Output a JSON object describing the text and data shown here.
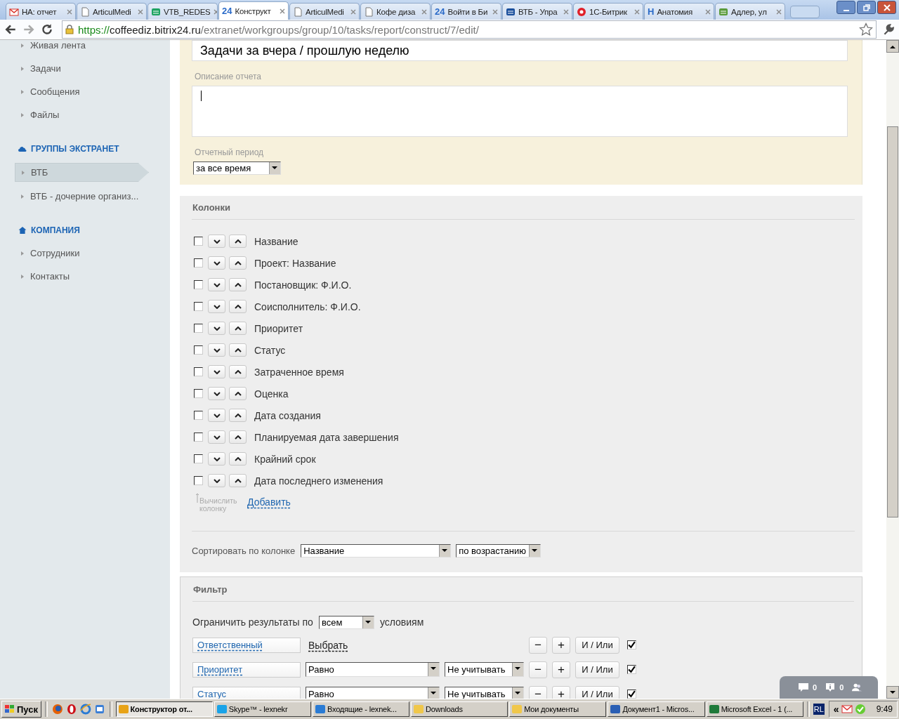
{
  "browser": {
    "tabs": [
      {
        "title": "НА: отчет",
        "kind": "mail",
        "selected": false
      },
      {
        "title": "ArticulMedi",
        "kind": "doc",
        "selected": false
      },
      {
        "title": "VTB_REDES",
        "kind": "sheet",
        "selected": false
      },
      {
        "title": "Конструкт",
        "kind": "mark",
        "mark": "24",
        "selected": true
      },
      {
        "title": "ArticulMedi",
        "kind": "doc",
        "selected": false
      },
      {
        "title": "Кофе диза",
        "kind": "doc",
        "selected": false
      },
      {
        "title": "Войти в Би",
        "kind": "mark",
        "mark": "24",
        "selected": false
      },
      {
        "title": "ВТБ - Упра",
        "kind": "bank",
        "selected": false
      },
      {
        "title": "1С-Битрик",
        "kind": "circle",
        "selected": false
      },
      {
        "title": "Анатомия",
        "kind": "mark",
        "mark": "H",
        "selected": false
      },
      {
        "title": "Адлер, ул",
        "kind": "map",
        "selected": false
      }
    ],
    "url_scheme": "https://",
    "url_host": "coffeediz.bitrix24.ru",
    "url_path": "/extranet/workgroups/group/10/tasks/report/construct/7/edit/"
  },
  "sidebar": {
    "sections": [
      {
        "items": [
          {
            "label": "Живая лента",
            "selected": false
          },
          {
            "label": "Задачи",
            "selected": false
          },
          {
            "label": "Сообщения",
            "selected": false
          },
          {
            "label": "Файлы",
            "selected": false
          }
        ]
      },
      {
        "title": "ГРУППЫ ЭКСТРАНЕТ",
        "kind": "cloud",
        "items": [
          {
            "label": "ВТБ",
            "selected": true
          },
          {
            "label": "ВТБ - дочерние организ...",
            "selected": false
          }
        ]
      },
      {
        "title": "КОМПАНИЯ",
        "kind": "home",
        "items": [
          {
            "label": "Сотрудники",
            "selected": false
          },
          {
            "label": "Контакты",
            "selected": false
          }
        ]
      }
    ]
  },
  "report": {
    "title_value": "Задачи за вчера / прошлую неделю",
    "description_label": "Описание отчета",
    "period_label": "Отчетный период",
    "period_value": "за все время"
  },
  "columns": {
    "title": "Колонки",
    "rows": [
      {
        "label": "Название",
        "checked": false
      },
      {
        "label": "Проект: Название",
        "checked": false
      },
      {
        "label": "Постановщик: Ф.И.О.",
        "checked": false
      },
      {
        "label": "Соисполнитель: Ф.И.О.",
        "checked": false
      },
      {
        "label": "Приоритет",
        "checked": false
      },
      {
        "label": "Статус",
        "checked": false
      },
      {
        "label": "Затраченное время",
        "checked": false
      },
      {
        "label": "Оценка",
        "checked": false
      },
      {
        "label": "Дата создания",
        "checked": false
      },
      {
        "label": "Планируемая дата завершения",
        "checked": false
      },
      {
        "label": "Крайний срок",
        "checked": false
      },
      {
        "label": "Дата последнего изменения",
        "checked": false
      }
    ],
    "calc_hint": "Вычислить колонку",
    "add_link": "Добавить",
    "sort_label": "Сортировать по колонке",
    "sort_value": "Название",
    "order_value": "по возрастанию"
  },
  "filter": {
    "title": "Фильтр",
    "limit_prefix": "Ограничить результаты по",
    "limit_value": "всем",
    "limit_suffix": "условиям",
    "conditions": [
      {
        "field": "Ответственный",
        "kind": "choose",
        "choose": "Выбрать",
        "minus": "−",
        "plus": "+",
        "andor": "И / Или",
        "checked": true
      },
      {
        "field": "Приоритет",
        "kind": "compare",
        "operator": "Равно",
        "value": "Не учитывать",
        "minus": "−",
        "plus": "+",
        "andor": "И / Или",
        "checked": true
      },
      {
        "field": "Статус",
        "kind": "compare",
        "operator": "Равно",
        "value": "Не учитывать",
        "minus": "−",
        "plus": "+",
        "andor": "И / Или",
        "checked": true
      }
    ]
  },
  "widget": {
    "messages": "0",
    "notifications": "0"
  },
  "taskbar": {
    "start": "Пуск",
    "windows": [
      {
        "title": "Конструктор от...",
        "kind": "chrome",
        "selected": true
      },
      {
        "title": "Skype™ - lexnekr",
        "kind": "skype",
        "selected": false
      },
      {
        "title": "Входящие - lexnek...",
        "kind": "ie",
        "selected": false
      },
      {
        "title": "Downloads",
        "kind": "folder",
        "selected": false
      },
      {
        "title": "Мои документы",
        "kind": "folder",
        "selected": false
      },
      {
        "title": "Документ1 - Micros...",
        "kind": "word",
        "selected": false
      },
      {
        "title": "Microsoft Excel - 1 (...",
        "kind": "excel",
        "selected": false
      }
    ],
    "lang": "RL",
    "chevron": "«",
    "time": "9:49"
  }
}
